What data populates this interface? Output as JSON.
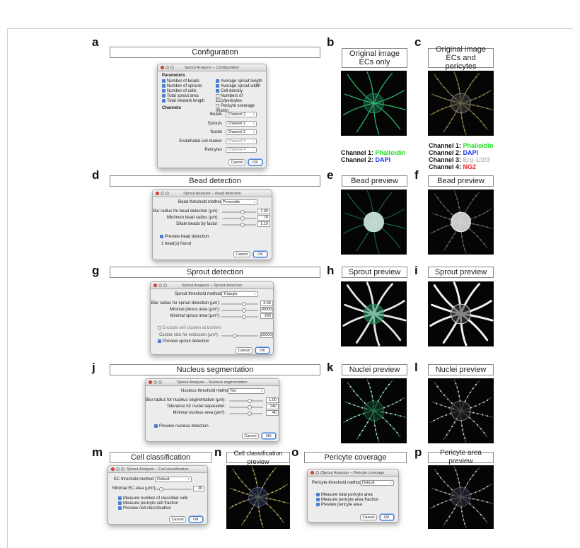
{
  "letters": [
    "a",
    "b",
    "c",
    "d",
    "e",
    "f",
    "g",
    "h",
    "i",
    "j",
    "k",
    "l",
    "m",
    "n",
    "o",
    "p"
  ],
  "headers": {
    "configuration": "Configuration",
    "orig_ecs": [
      "Original image",
      "ECs only"
    ],
    "orig_peri": [
      "Original image",
      "ECs and pericytes"
    ],
    "bead_detection": "Bead detection",
    "bead_preview": "Bead preview",
    "sprout_detection": "Sprout detection",
    "sprout_preview": "Sprout preview",
    "nucleus_segmentation": "Nucleus segmentation",
    "nuclei_preview": "Nuclei preview",
    "cell_classification": "Cell classification",
    "cell_classification_preview": "Cell classification preview",
    "pericyte_coverage": "Pericyte coverage",
    "pericyte_area_preview": "Pericyte area preview"
  },
  "legend_b": [
    {
      "label": "Channel 1:",
      "value": "Phalloidin",
      "color": "#22dd22"
    },
    {
      "label": "Channel 2:",
      "value": "DAPI",
      "color": "#2233ee"
    }
  ],
  "legend_c": [
    {
      "label": "Channel 1:",
      "value": "Phalloidin",
      "color": "#22dd22"
    },
    {
      "label": "Channel 2:",
      "value": "DAPI",
      "color": "#2233ee"
    },
    {
      "label": "Channel 3:",
      "value": "Erg-1/2/3",
      "color": "#bbbbbb"
    },
    {
      "label": "Channel 4:",
      "value": "NG2",
      "color": "#ee2222"
    }
  ],
  "config": {
    "title": "Sprout Analyzer – Configuration",
    "parameters": "Parameters",
    "left": [
      "Number of beads",
      "Number of sprouts",
      "Number of cells",
      "Total sprout area",
      "Total network length"
    ],
    "right": [
      "Average sprout length",
      "Average sprout width",
      "Cell density",
      "Numbers of ECs/pericytes",
      "Pericyte coverage (Ratio)"
    ],
    "channels": "Channels",
    "ch_rows": [
      {
        "label": "Beads",
        "value": "Channel 2"
      },
      {
        "label": "Sprouts",
        "value": "Channel 1"
      },
      {
        "label": "Nuclei",
        "value": "Channel 2"
      },
      {
        "label": "Endothelial cell marker",
        "value": "Channel 3"
      },
      {
        "label": "Pericytes",
        "value": "Channel 4"
      }
    ],
    "cancel": "Cancel",
    "ok": "OK"
  },
  "bead": {
    "title": "Sprout Analyzer – Bead detection",
    "method_label": "Bead threshold method",
    "method": "Percentile",
    "rows": [
      {
        "label": "Blur radius for bead detection (µm):",
        "value": "2.00"
      },
      {
        "label": "Minimum bead radius (µm):",
        "value": "70"
      },
      {
        "label": "Dilate beads by factor:",
        "value": "1.10"
      }
    ],
    "preview": "Preview bead detection",
    "found": "1 bead(s) found",
    "cancel": "Cancel",
    "ok": "OK"
  },
  "sprout": {
    "title": "Sprout Analyzer – Sprout detection",
    "method_label": "Sprout threshold method",
    "method": "Triangle",
    "rows": [
      {
        "label": "Blur radius for sprout detection (µm):",
        "value": "3.00"
      },
      {
        "label": "Minimal plexus area (µm²):",
        "value": "20000"
      },
      {
        "label": "Minimal sprout area (µm²):",
        "value": "200"
      }
    ],
    "exclude": "Exclude cell clusters at borders",
    "cluster_label": "Cluster size for exclusion (µm²):",
    "cluster": "20000",
    "preview": "Preview sprout detection",
    "cancel": "Cancel",
    "ok": "OK"
  },
  "nucleus": {
    "title": "Sprout Analyzer – Nucleus segmentation",
    "method_label": "Nucleus threshold method",
    "method": "Yen",
    "rows": [
      {
        "label": "Blur radius for nucleus segmentation (µm):",
        "value": "1.00"
      },
      {
        "label": "Tolerance for nuclei separation:",
        "value": "240"
      },
      {
        "label": "Minimal nucleus area (µm²):",
        "value": "40"
      }
    ],
    "preview": "Preview nucleus detection",
    "cancel": "Cancel",
    "ok": "OK"
  },
  "cellclass": {
    "title": "Sprout Analyzer – Cell classification",
    "method_label": "EC threshold method",
    "method": "Default",
    "area_label": "Minimal EC area (µm²):",
    "area": "30",
    "checks": [
      "Measure number of classified cells",
      "Measure pericyte cell fraction",
      "Preview cell classification"
    ],
    "cancel": "Cancel",
    "ok": "OK"
  },
  "pericyte": {
    "title": "Sprout Analyzer – Pericyte coverage",
    "method_label": "Pericyte threshold method",
    "method": "Default",
    "checks": [
      "Measure total pericyte area",
      "Measure pericyte area fraction",
      "Preview pericyte area"
    ],
    "cancel": "Cancel",
    "ok": "OK"
  }
}
